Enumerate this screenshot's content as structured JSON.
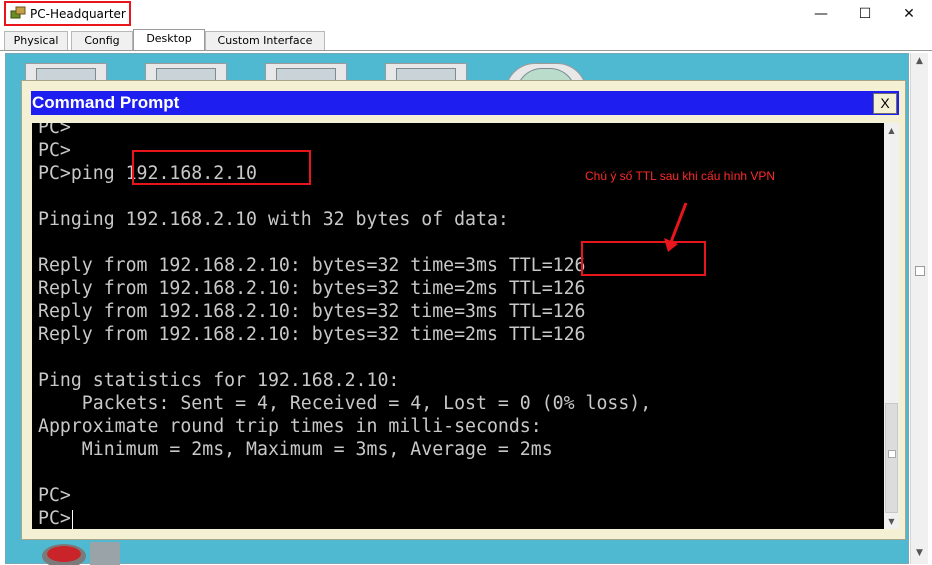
{
  "window": {
    "title": "PC-Headquarter",
    "minimize_glyph": "—",
    "maximize_glyph": "☐",
    "close_glyph": "✕"
  },
  "tabs": [
    {
      "label": "Physical"
    },
    {
      "label": "Config"
    },
    {
      "label": "Desktop",
      "active": true
    },
    {
      "label": "Custom Interface"
    }
  ],
  "command_prompt": {
    "title": "Command Prompt",
    "close_label": "X",
    "lines": [
      "PC>",
      "PC>",
      "PC>ping 192.168.2.10",
      "",
      "Pinging 192.168.2.10 with 32 bytes of data:",
      "",
      "Reply from 192.168.2.10: bytes=32 time=3ms TTL=126",
      "Reply from 192.168.2.10: bytes=32 time=2ms TTL=126",
      "Reply from 192.168.2.10: bytes=32 time=3ms TTL=126",
      "Reply from 192.168.2.10: bytes=32 time=2ms TTL=126",
      "",
      "Ping statistics for 192.168.2.10:",
      "    Packets: Sent = 4, Received = 4, Lost = 0 (0% loss),",
      "Approximate round trip times in milli-seconds:",
      "    Minimum = 2ms, Maximum = 3ms, Average = 2ms",
      "",
      "PC>",
      "PC>"
    ]
  },
  "annotation": {
    "note": "Chú ý số TTL sau khi cấu hình VPN",
    "color": "#e8161c"
  },
  "icons": {
    "app": "pc-icon",
    "scroll_up": "chevron-up-icon",
    "scroll_down": "chevron-down-icon"
  }
}
